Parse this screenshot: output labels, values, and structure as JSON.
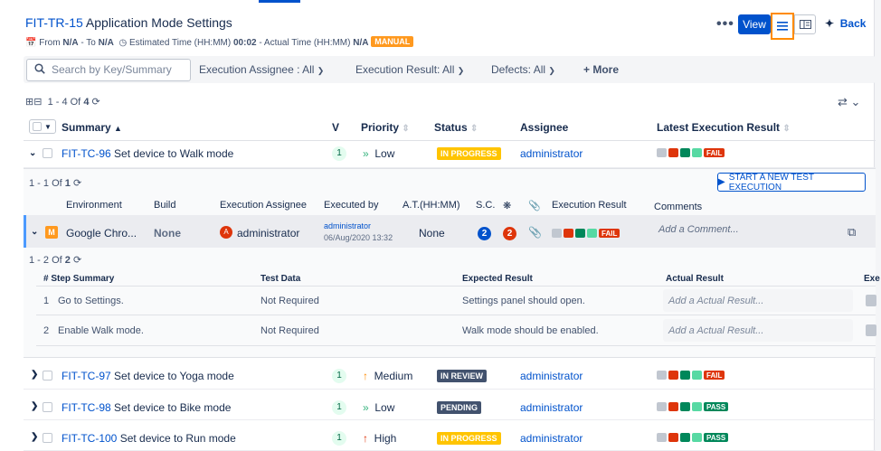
{
  "header": {
    "issue_key": "FIT-TR-15",
    "issue_title": "Application Mode Settings",
    "from_label": "From",
    "from_value": "N/A",
    "to_label": "- To",
    "to_value": "N/A",
    "estimated_label": "Estimated Time (HH:MM)",
    "estimated_value": "00:02",
    "actual_label": "- Actual Time (HH:MM)",
    "actual_value": "N/A",
    "type_badge": "MANUAL",
    "more": "•••",
    "view_label": "View",
    "back_label": "Back"
  },
  "filters": {
    "search_placeholder": "Search by Key/Summary",
    "assignee": "Execution Assignee :  All",
    "result": "Execution Result: All",
    "defects": "Defects: All",
    "more": "+ More"
  },
  "counter": {
    "range": "1 - 4 Of",
    "total": "4"
  },
  "columns": {
    "summary": "Summary",
    "v": "V",
    "priority": "Priority",
    "status": "Status",
    "assignee": "Assignee",
    "latest": "Latest Execution Result"
  },
  "rows": [
    {
      "key": "FIT-TC-96",
      "summary": "Set device to Walk mode",
      "v": "1",
      "priority": "Low",
      "status": "IN PROGRESS",
      "status_color": "#ffc400",
      "assignee": "administrator",
      "result": "FAIL",
      "result_color": "#de350b"
    },
    {
      "key": "FIT-TC-97",
      "summary": "Set device to Yoga mode",
      "v": "1",
      "priority": "Medium",
      "status": "IN REVIEW",
      "status_color": "#42526e",
      "assignee": "administrator",
      "result": "FAIL",
      "result_color": "#de350b"
    },
    {
      "key": "FIT-TC-98",
      "summary": "Set device to Bike mode",
      "v": "1",
      "priority": "Low",
      "status": "PENDING",
      "status_color": "#42526e",
      "assignee": "administrator",
      "result": "PASS",
      "result_color": "#00875a"
    },
    {
      "key": "FIT-TC-100",
      "summary": "Set device to Run mode",
      "v": "1",
      "priority": "High",
      "status": "IN PROGRESS",
      "status_color": "#ffc400",
      "assignee": "administrator",
      "result": "PASS",
      "result_color": "#00875a"
    }
  ],
  "executions": {
    "counter_range": "1 - 1 Of",
    "counter_total": "1",
    "start_label": "START A NEW TEST EXECUTION",
    "headers": {
      "environment": "Environment",
      "build": "Build",
      "assignee": "Execution Assignee",
      "executed_by": "Executed by",
      "at": "A.T.(HH:MM)",
      "sc": "S.C.",
      "result": "Execution Result",
      "comments": "Comments"
    },
    "row": {
      "env_badge": "M",
      "environment": "Google Chro...",
      "build": "None",
      "avatar_letter": "A",
      "assignee": "administrator",
      "executed_by": "administrator",
      "executed_on": "06/Aug/2020 13:32",
      "at": "None",
      "sc_count": "2",
      "defect_count": "2",
      "result": "FAIL",
      "comment_placeholder": "Add a Comment..."
    }
  },
  "steps": {
    "counter_range": "1 - 2 Of",
    "counter_total": "2",
    "headers": {
      "step": "# Step Summary",
      "data": "Test Data",
      "expected": "Expected Result",
      "actual": "Actual Result",
      "exe": "Exe"
    },
    "items": [
      {
        "num": "1",
        "summary": "Go to Settings.",
        "data": "Not Required",
        "expected": "Settings panel should open.",
        "actual_placeholder": "Add a Actual Result..."
      },
      {
        "num": "2",
        "summary": "Enable Walk mode.",
        "data": "Not Required",
        "expected": "Walk mode should be enabled.",
        "actual_placeholder": "Add a Actual Result..."
      }
    ]
  },
  "colors": {
    "accent": "#0052cc",
    "highlight_border": "#ff8b00",
    "fail": "#de350b",
    "pass": "#00875a",
    "bar_grey": "#c1c7d0",
    "bar_red": "#de350b",
    "bar_green": "#00875a",
    "bar_teal": "#57d9a3"
  }
}
